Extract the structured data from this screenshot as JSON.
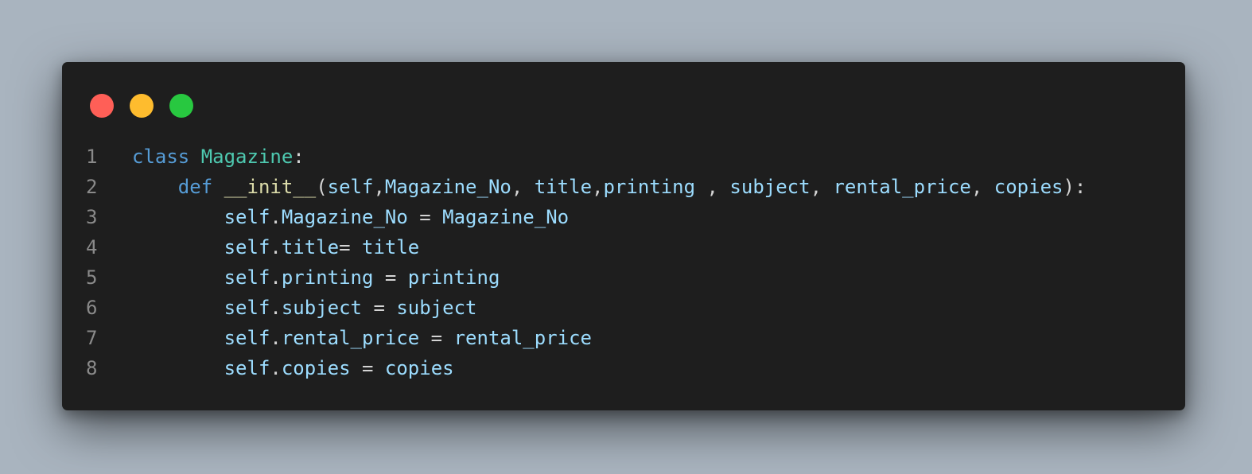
{
  "window": {
    "controls": [
      {
        "name": "close",
        "color": "#ff5f57"
      },
      {
        "name": "minimize",
        "color": "#febc2e"
      },
      {
        "name": "maximize",
        "color": "#28c840"
      }
    ]
  },
  "code": {
    "language": "python",
    "lines": [
      {
        "number": "1",
        "tokens": [
          {
            "t": "class",
            "k": "kw"
          },
          {
            "t": " ",
            "k": "punc"
          },
          {
            "t": "Magazine",
            "k": "cls"
          },
          {
            "t": ":",
            "k": "punc"
          }
        ]
      },
      {
        "number": "2",
        "tokens": [
          {
            "t": "    ",
            "k": "punc"
          },
          {
            "t": "def",
            "k": "kw"
          },
          {
            "t": " ",
            "k": "punc"
          },
          {
            "t": "__init__",
            "k": "fn"
          },
          {
            "t": "(",
            "k": "punc"
          },
          {
            "t": "self",
            "k": "var"
          },
          {
            "t": ",",
            "k": "punc"
          },
          {
            "t": "Magazine_No",
            "k": "var"
          },
          {
            "t": ", ",
            "k": "punc"
          },
          {
            "t": "title",
            "k": "var"
          },
          {
            "t": ",",
            "k": "punc"
          },
          {
            "t": "printing",
            "k": "var"
          },
          {
            "t": " , ",
            "k": "punc"
          },
          {
            "t": "subject",
            "k": "var"
          },
          {
            "t": ", ",
            "k": "punc"
          },
          {
            "t": "rental_price",
            "k": "var"
          },
          {
            "t": ", ",
            "k": "punc"
          },
          {
            "t": "copies",
            "k": "var"
          },
          {
            "t": "):",
            "k": "punc"
          }
        ]
      },
      {
        "number": "3",
        "tokens": [
          {
            "t": "        ",
            "k": "punc"
          },
          {
            "t": "self",
            "k": "var"
          },
          {
            "t": ".",
            "k": "punc"
          },
          {
            "t": "Magazine_No",
            "k": "var"
          },
          {
            "t": " = ",
            "k": "punc"
          },
          {
            "t": "Magazine_No",
            "k": "var"
          }
        ]
      },
      {
        "number": "4",
        "tokens": [
          {
            "t": "        ",
            "k": "punc"
          },
          {
            "t": "self",
            "k": "var"
          },
          {
            "t": ".",
            "k": "punc"
          },
          {
            "t": "title",
            "k": "var"
          },
          {
            "t": "= ",
            "k": "punc"
          },
          {
            "t": "title",
            "k": "var"
          }
        ]
      },
      {
        "number": "5",
        "tokens": [
          {
            "t": "        ",
            "k": "punc"
          },
          {
            "t": "self",
            "k": "var"
          },
          {
            "t": ".",
            "k": "punc"
          },
          {
            "t": "printing",
            "k": "var"
          },
          {
            "t": " = ",
            "k": "punc"
          },
          {
            "t": "printing",
            "k": "var"
          }
        ]
      },
      {
        "number": "6",
        "tokens": [
          {
            "t": "        ",
            "k": "punc"
          },
          {
            "t": "self",
            "k": "var"
          },
          {
            "t": ".",
            "k": "punc"
          },
          {
            "t": "subject",
            "k": "var"
          },
          {
            "t": " = ",
            "k": "punc"
          },
          {
            "t": "subject",
            "k": "var"
          }
        ]
      },
      {
        "number": "7",
        "tokens": [
          {
            "t": "        ",
            "k": "punc"
          },
          {
            "t": "self",
            "k": "var"
          },
          {
            "t": ".",
            "k": "punc"
          },
          {
            "t": "rental_price",
            "k": "var"
          },
          {
            "t": " = ",
            "k": "punc"
          },
          {
            "t": "rental_price",
            "k": "var"
          }
        ]
      },
      {
        "number": "8",
        "tokens": [
          {
            "t": "        ",
            "k": "punc"
          },
          {
            "t": "self",
            "k": "var"
          },
          {
            "t": ".",
            "k": "punc"
          },
          {
            "t": "copies",
            "k": "var"
          },
          {
            "t": " = ",
            "k": "punc"
          },
          {
            "t": "copies",
            "k": "var"
          }
        ]
      }
    ]
  }
}
